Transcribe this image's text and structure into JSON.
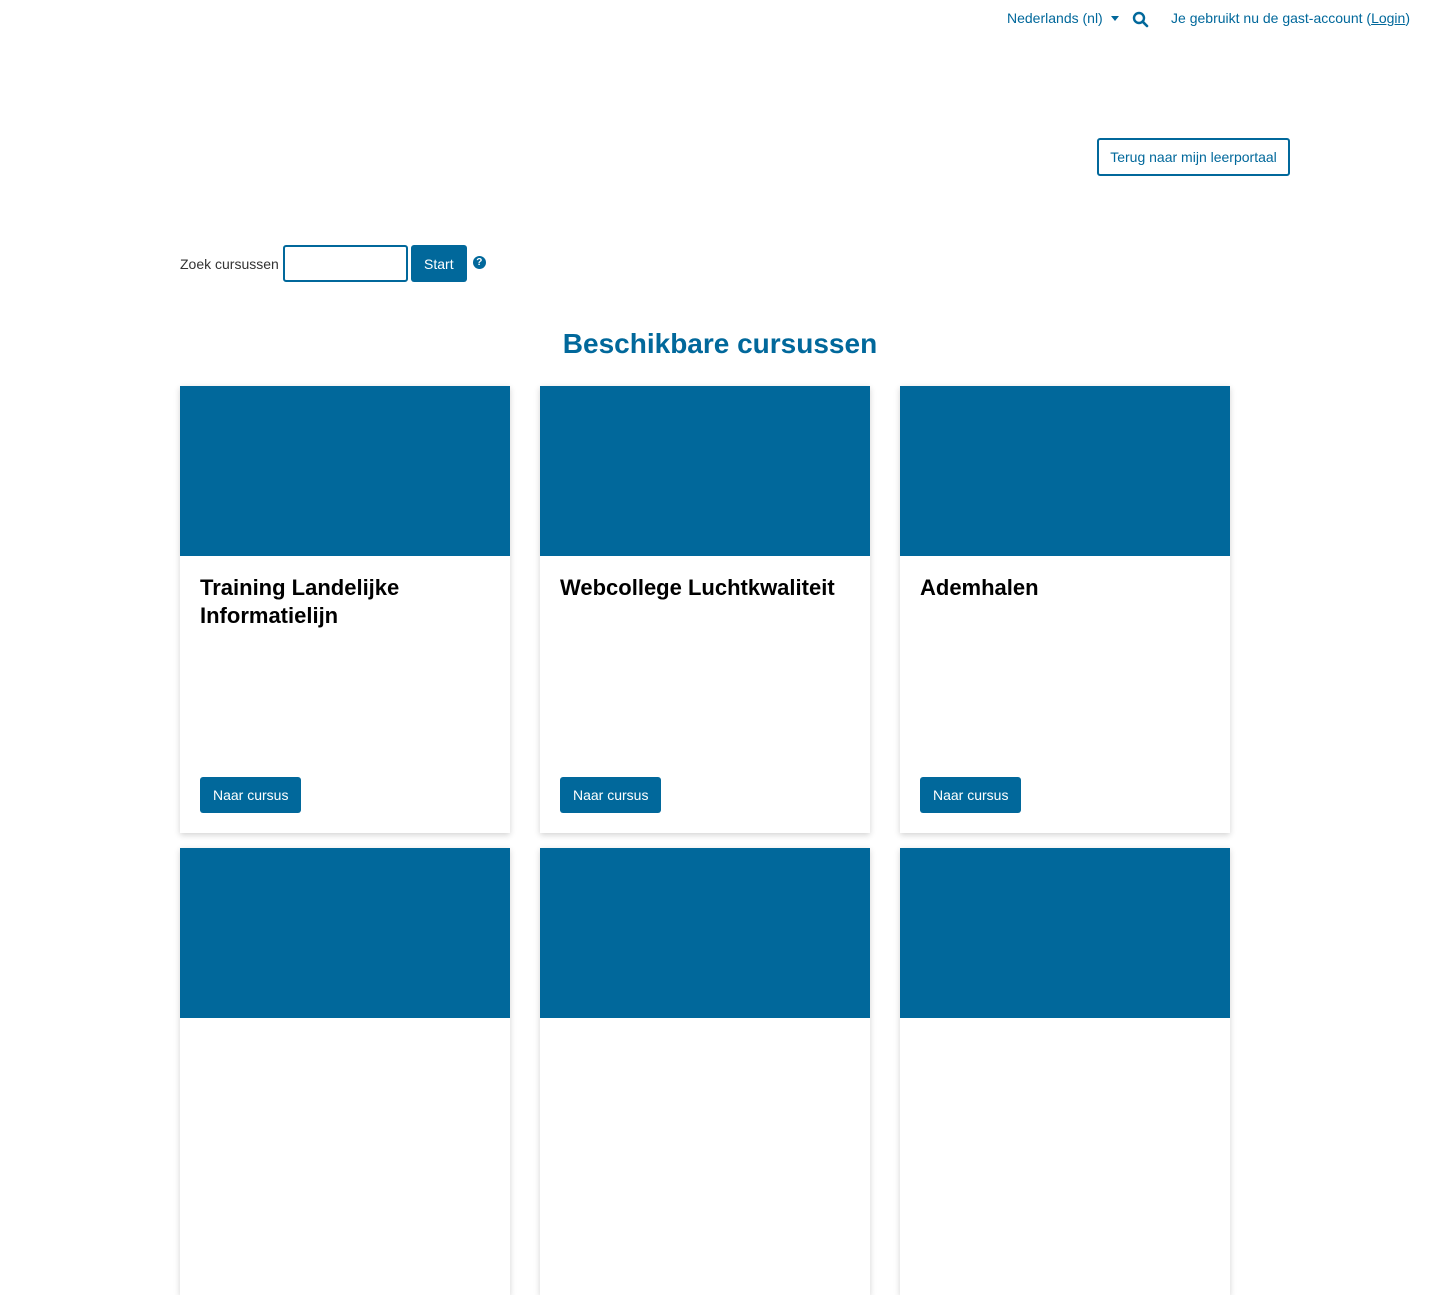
{
  "navbar": {
    "language_label": "Nederlands (nl)",
    "search_icon": "search-icon",
    "guest_prefix": "Je gebruikt nu de gast-account (",
    "login_label": "Login",
    "guest_suffix": ")"
  },
  "back_button_label": "Terug naar mijn leerportaal",
  "search": {
    "label": "Zoek cursussen",
    "input_value": "",
    "submit_label": "Start",
    "help_icon": "question-circle-icon"
  },
  "heading": "Beschikbare cursussen",
  "courses": [
    {
      "title": "Training Landelijke Informatielijn",
      "button_label": "Naar cursus"
    },
    {
      "title": "Webcollege Luchtkwaliteit",
      "button_label": "Naar cursus"
    },
    {
      "title": "Ademhalen",
      "button_label": "Naar cursus"
    }
  ],
  "colors": {
    "primary": "#01689b",
    "heading_text": "#000000"
  }
}
